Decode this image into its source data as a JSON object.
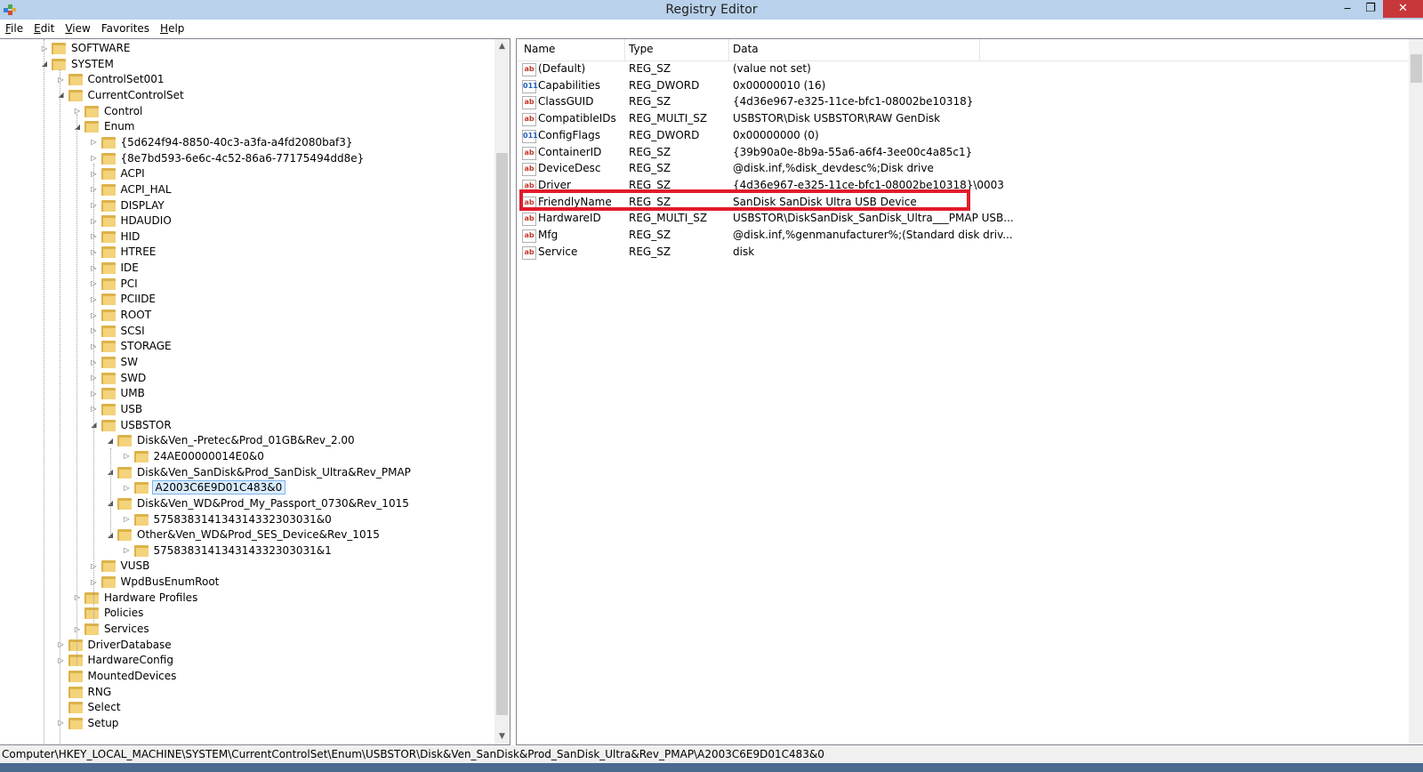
{
  "window": {
    "title": "Registry Editor",
    "minimize_glyph": "‒",
    "maximize_glyph": "❐",
    "close_glyph": "✕"
  },
  "menu": [
    {
      "underline": "F",
      "rest": "ile"
    },
    {
      "underline": "E",
      "rest": "dit"
    },
    {
      "underline": "V",
      "rest": "iew"
    },
    {
      "underline": "",
      "rest": "Favorites"
    },
    {
      "underline": "H",
      "rest": "elp"
    }
  ],
  "tree": [
    {
      "label": "SOFTWARE",
      "level": 0,
      "expander": "▷"
    },
    {
      "label": "SYSTEM",
      "level": 0,
      "expander": "◢"
    },
    {
      "label": "ControlSet001",
      "level": 1,
      "expander": "▷"
    },
    {
      "label": "CurrentControlSet",
      "level": 1,
      "expander": "◢"
    },
    {
      "label": "Control",
      "level": 2,
      "expander": "▷"
    },
    {
      "label": "Enum",
      "level": 2,
      "expander": "◢"
    },
    {
      "label": "{5d624f94-8850-40c3-a3fa-a4fd2080baf3}",
      "level": 3,
      "expander": "▷"
    },
    {
      "label": "{8e7bd593-6e6c-4c52-86a6-77175494dd8e}",
      "level": 3,
      "expander": "▷"
    },
    {
      "label": "ACPI",
      "level": 3,
      "expander": "▷"
    },
    {
      "label": "ACPI_HAL",
      "level": 3,
      "expander": "▷"
    },
    {
      "label": "DISPLAY",
      "level": 3,
      "expander": "▷"
    },
    {
      "label": "HDAUDIO",
      "level": 3,
      "expander": "▷"
    },
    {
      "label": "HID",
      "level": 3,
      "expander": "▷"
    },
    {
      "label": "HTREE",
      "level": 3,
      "expander": "▷"
    },
    {
      "label": "IDE",
      "level": 3,
      "expander": "▷"
    },
    {
      "label": "PCI",
      "level": 3,
      "expander": "▷"
    },
    {
      "label": "PCIIDE",
      "level": 3,
      "expander": "▷"
    },
    {
      "label": "ROOT",
      "level": 3,
      "expander": "▷"
    },
    {
      "label": "SCSI",
      "level": 3,
      "expander": "▷"
    },
    {
      "label": "STORAGE",
      "level": 3,
      "expander": "▷"
    },
    {
      "label": "SW",
      "level": 3,
      "expander": "▷"
    },
    {
      "label": "SWD",
      "level": 3,
      "expander": "▷"
    },
    {
      "label": "UMB",
      "level": 3,
      "expander": "▷"
    },
    {
      "label": "USB",
      "level": 3,
      "expander": "▷"
    },
    {
      "label": "USBSTOR",
      "level": 3,
      "expander": "◢"
    },
    {
      "label": "Disk&Ven_-Pretec&Prod_01GB&Rev_2.00",
      "level": 4,
      "expander": "◢"
    },
    {
      "label": "24AE00000014E0&0",
      "level": 5,
      "expander": "▷"
    },
    {
      "label": "Disk&Ven_SanDisk&Prod_SanDisk_Ultra&Rev_PMAP",
      "level": 4,
      "expander": "◢"
    },
    {
      "label": "A2003C6E9D01C483&0",
      "level": 5,
      "expander": "▷",
      "selected": true
    },
    {
      "label": "Disk&Ven_WD&Prod_My_Passport_0730&Rev_1015",
      "level": 4,
      "expander": "◢"
    },
    {
      "label": "575838314134314332303031&0",
      "level": 5,
      "expander": "▷"
    },
    {
      "label": "Other&Ven_WD&Prod_SES_Device&Rev_1015",
      "level": 4,
      "expander": "◢"
    },
    {
      "label": "575838314134314332303031&1",
      "level": 5,
      "expander": "▷"
    },
    {
      "label": "VUSB",
      "level": 3,
      "expander": "▷"
    },
    {
      "label": "WpdBusEnumRoot",
      "level": 3,
      "expander": "▷"
    },
    {
      "label": "Hardware Profiles",
      "level": 2,
      "expander": "▷"
    },
    {
      "label": "Policies",
      "level": 2,
      "expander": ""
    },
    {
      "label": "Services",
      "level": 2,
      "expander": "▷"
    },
    {
      "label": "DriverDatabase",
      "level": 1,
      "expander": "▷"
    },
    {
      "label": "HardwareConfig",
      "level": 1,
      "expander": "▷"
    },
    {
      "label": "MountedDevices",
      "level": 1,
      "expander": ""
    },
    {
      "label": "RNG",
      "level": 1,
      "expander": ""
    },
    {
      "label": "Select",
      "level": 1,
      "expander": ""
    },
    {
      "label": "Setup",
      "level": 1,
      "expander": "▷"
    }
  ],
  "values_header": {
    "name": "Name",
    "type": "Type",
    "data": "Data"
  },
  "values": [
    {
      "icon": "ab",
      "name": "(Default)",
      "type": "REG_SZ",
      "data": "(value not set)"
    },
    {
      "icon": "011",
      "name": "Capabilities",
      "type": "REG_DWORD",
      "data": "0x00000010 (16)"
    },
    {
      "icon": "ab",
      "name": "ClassGUID",
      "type": "REG_SZ",
      "data": "{4d36e967-e325-11ce-bfc1-08002be10318}"
    },
    {
      "icon": "ab",
      "name": "CompatibleIDs",
      "type": "REG_MULTI_SZ",
      "data": "USBSTOR\\Disk USBSTOR\\RAW GenDisk"
    },
    {
      "icon": "011",
      "name": "ConfigFlags",
      "type": "REG_DWORD",
      "data": "0x00000000 (0)"
    },
    {
      "icon": "ab",
      "name": "ContainerID",
      "type": "REG_SZ",
      "data": "{39b90a0e-8b9a-55a6-a6f4-3ee00c4a85c1}"
    },
    {
      "icon": "ab",
      "name": "DeviceDesc",
      "type": "REG_SZ",
      "data": "@disk.inf,%disk_devdesc%;Disk drive"
    },
    {
      "icon": "ab",
      "name": "Driver",
      "type": "REG_SZ",
      "data": "{4d36e967-e325-11ce-bfc1-08002be10318}\\0003"
    },
    {
      "icon": "ab",
      "name": "FriendlyName",
      "type": "REG_SZ",
      "data": "SanDisk SanDisk Ultra USB Device"
    },
    {
      "icon": "ab",
      "name": "HardwareID",
      "type": "REG_MULTI_SZ",
      "data": "USBSTOR\\DiskSanDisk_SanDisk_Ultra___PMAP USB..."
    },
    {
      "icon": "ab",
      "name": "Mfg",
      "type": "REG_SZ",
      "data": "@disk.inf,%genmanufacturer%;(Standard disk driv..."
    },
    {
      "icon": "ab",
      "name": "Service",
      "type": "REG_SZ",
      "data": "disk"
    }
  ],
  "status_path": "Computer\\HKEY_LOCAL_MACHINE\\SYSTEM\\CurrentControlSet\\Enum\\USBSTOR\\Disk&Ven_SanDisk&Prod_SanDisk_Ultra&Rev_PMAP\\A2003C6E9D01C483&0",
  "icons": {
    "scroll_up": "▲",
    "scroll_down": "▼",
    "app": "registry-editor-icon"
  },
  "colors": {
    "titlebar": "#b9d1ea",
    "highlight": "#e21b2b",
    "folder": "#f3d37b"
  }
}
